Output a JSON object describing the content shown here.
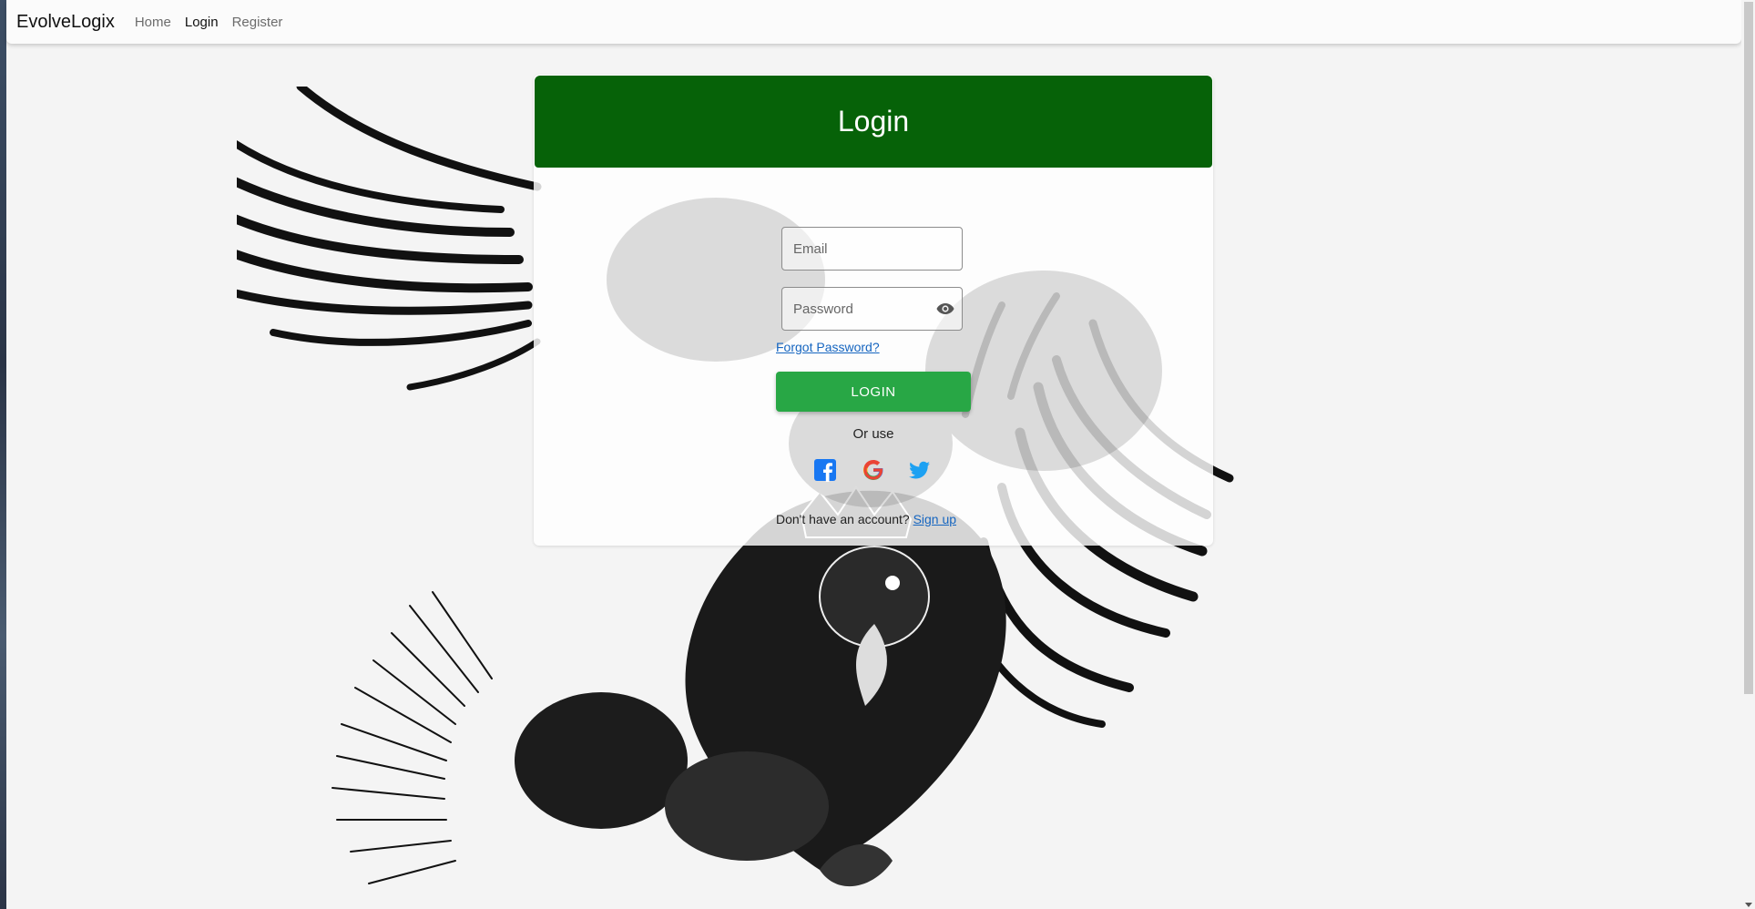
{
  "navbar": {
    "brand": "EvolveLogix",
    "links": [
      {
        "label": "Home",
        "active": false
      },
      {
        "label": "Login",
        "active": true
      },
      {
        "label": "Register",
        "active": false
      }
    ]
  },
  "card": {
    "title": "Login",
    "email_placeholder": "Email",
    "password_placeholder": "Password",
    "forgot_label": "Forgot Password?",
    "login_label": "LOGIN",
    "or_use": "Or use",
    "social": [
      {
        "name": "facebook",
        "icon": "facebook-icon",
        "color": "#1877f2"
      },
      {
        "name": "google",
        "icon": "google-icon",
        "color": "#ea4335"
      },
      {
        "name": "twitter",
        "icon": "twitter-icon",
        "color": "#1da1f2"
      }
    ],
    "signup_prompt": "Don't have an account?",
    "signup_label": "Sign up"
  },
  "colors": {
    "header_green": "#066208",
    "button_green": "#28a745",
    "link_blue": "#1565c0"
  }
}
